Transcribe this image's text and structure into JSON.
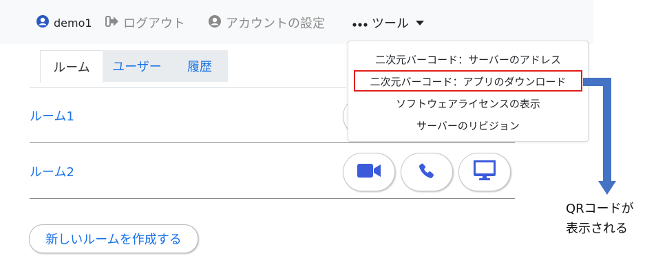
{
  "navbar": {
    "user": "demo1",
    "logout": "ログアウト",
    "account_settings": "アカウントの設定",
    "tools": "ツール"
  },
  "tabs": [
    "ルーム",
    "ユーザー",
    "履歴"
  ],
  "rooms": [
    {
      "name": "ルーム1"
    },
    {
      "name": "ルーム2"
    }
  ],
  "room_buttons": [
    "video-icon",
    "phone-icon",
    "monitor-icon"
  ],
  "create_room": "新しいルームを作成する",
  "tools_menu": [
    "二次元バーコード：サーバーのアドレス",
    "二次元バーコード：アプリのダウンロード",
    "ソフトウェアライセンスの表示",
    "サーバーのリビジョン"
  ],
  "annotation": [
    "QRコードが",
    "表示される"
  ],
  "colors": {
    "link": "#1a73e8",
    "icon_blue": "#3b5bdb",
    "highlight": "#e21b1b",
    "arrow": "#4472c4"
  }
}
